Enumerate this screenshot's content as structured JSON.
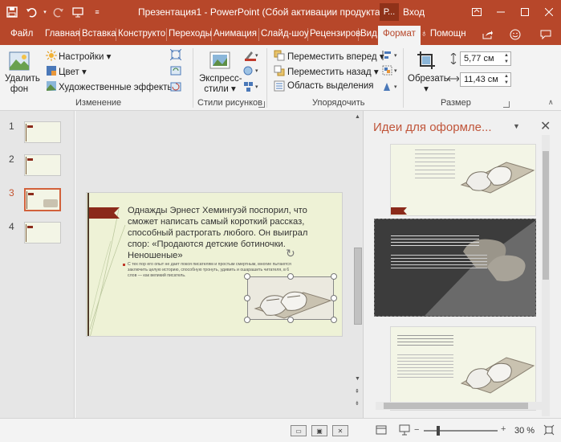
{
  "titlebar": {
    "title": "Презентация1 - PowerPoint (Сбой активации продукта)",
    "account_initial": "Р...",
    "sign_in": "Вход"
  },
  "tabs": [
    {
      "label": "Файл"
    },
    {
      "label": "Главная"
    },
    {
      "label": "Вставка"
    },
    {
      "label": "Конструкто"
    },
    {
      "label": "Переходы"
    },
    {
      "label": "Анимация"
    },
    {
      "label": "Слайд-шоу"
    },
    {
      "label": "Рецензиров"
    },
    {
      "label": "Вид"
    },
    {
      "label": "Формат"
    }
  ],
  "tell_me": "Помощн",
  "ribbon": {
    "remove_bg_line1": "Удалить",
    "remove_bg_line2": "фон",
    "settings": "Настройки",
    "color": "Цвет",
    "artistic": "Художественные эффекты",
    "group_adjust": "Изменение",
    "express_line1": "Экспресс-",
    "express_line2": "стили",
    "group_styles": "Стили рисунков",
    "bring_forward": "Переместить вперед",
    "send_backward": "Переместить назад",
    "selection_pane": "Область выделения",
    "group_arrange": "Упорядочить",
    "crop": "Обрезать",
    "height": "5,77 см",
    "width": "11,43 см",
    "group_size": "Размер"
  },
  "slides": [
    {
      "number": "1"
    },
    {
      "number": "2"
    },
    {
      "number": "3"
    },
    {
      "number": "4"
    }
  ],
  "slide": {
    "heading": "Однажды Эрнест Хемингуэй поспорил, что сможет написать самый короткий рассказ, способный растрогать любого. Он выиграл спор: «Продаются детские ботиночки. Неношеные»",
    "body": "С тех пор его опыт не дает покоя писателям и простым смертным, многие пытаются заключить целую историю, способную тронуть, удивить и ошарашить читателя, в 6 слов — как великий писатель."
  },
  "design_pane": {
    "title": "Идеи для оформле..."
  },
  "status": {
    "zoom": "30 %"
  },
  "colors": {
    "accent": "#b7472a",
    "slide_bg": "#eef2d6",
    "ribbon_mark": "#8b2a1a"
  }
}
